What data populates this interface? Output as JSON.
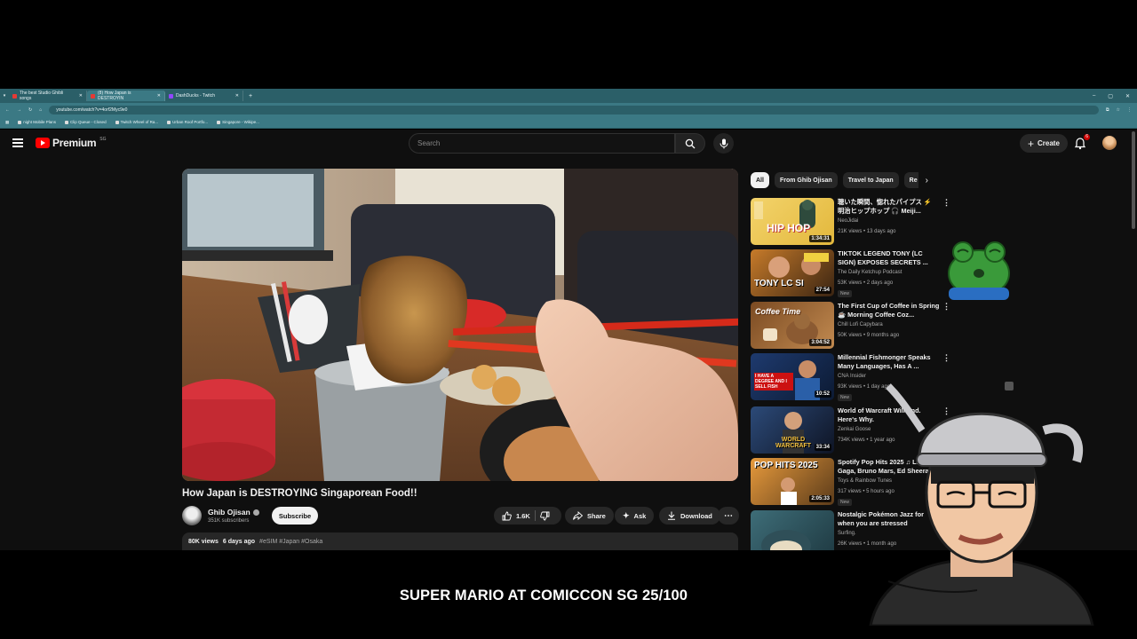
{
  "browser": {
    "tabs": [
      {
        "label": "The best Studio Ghibli songs"
      },
      {
        "label": "(8) How Japan is DESTROYIN"
      },
      {
        "label": "DashDucks - Twitch"
      }
    ],
    "new_tab": "+",
    "window_controls": [
      "–",
      "▢",
      "✕"
    ],
    "url": "youtube.com/watch?v=4orf2Myc9e0",
    "bookmarks": [
      "night Mobile Plans",
      "Clip Queue - Closed",
      "Twitch Wheel of Ra...",
      "Urban Roof Portfo...",
      "Singapore - Wikipe..."
    ]
  },
  "youtube": {
    "logo_text": "Premium",
    "logo_region": "SG",
    "search_placeholder": "Search",
    "create_label": "Create",
    "notification_count": "6"
  },
  "video": {
    "title": "How Japan is DESTROYING Singaporean Food!!",
    "channel": "Ghib Ojisan",
    "subscribers": "351K subscribers",
    "subscribe_label": "Subscribe",
    "likes": "1.6K",
    "share_label": "Share",
    "ask_label": "Ask",
    "download_label": "Download",
    "views": "80K views",
    "age": "6 days ago",
    "tags": "#eSIM #Japan #Osaka"
  },
  "chips": [
    "All",
    "From Ghib Ojisan",
    "Travel to Japan",
    "Re"
  ],
  "recommendations": [
    {
      "title": "聴いた瞬間、惚れたパイプス ⚡ 明治ヒップホップ 🎧 Meiji...",
      "channel": "NeoJidai",
      "views": "21K views",
      "age": "13 days ago",
      "duration": "1:34:31",
      "thumb_text": "HIP HOP",
      "new": false
    },
    {
      "title": "TIKTOK LEGEND TONY (LC SIGN) EXPOSES SECRETS ...",
      "channel": "The Daily Ketchup Podcast",
      "views": "53K views",
      "age": "2 days ago",
      "duration": "27:54",
      "thumb_text": "TONY LC SI",
      "new": true
    },
    {
      "title": "The First Cup of Coffee in Spring ☕ Morning Coffee Coz...",
      "channel": "Chill Lofi Capybara",
      "views": "50K views",
      "age": "9 months ago",
      "duration": "3:04:52",
      "thumb_text": "Coffee Time",
      "new": false
    },
    {
      "title": "Millennial Fishmonger Speaks Many Languages, Has A ...",
      "channel": "CNA Insider",
      "views": "93K views",
      "age": "1 day ago",
      "duration": "10:52",
      "thumb_text": "I HAVE A DEGREE AND I SELL FISH",
      "new": true
    },
    {
      "title": "World of Warcraft Will End. Here's Why.",
      "channel": "Zenkai Goose",
      "views": "734K views",
      "age": "1 year ago",
      "duration": "33:34",
      "thumb_text": "WORLD WARCRAFT",
      "new": false
    },
    {
      "title": "Spotify Pop Hits 2025 ♫ Lady Gaga, Bruno Mars, Ed Sheeran...",
      "channel": "Toys & Rainbow Tunes",
      "views": "317 views",
      "age": "5 hours ago",
      "duration": "2:05:33",
      "thumb_text": "POP HITS 2025",
      "new": true
    },
    {
      "title": "Nostalgic Pokémon Jazz for when you are stressed",
      "channel": "Surfing.",
      "views": "26K views",
      "age": "1 month ago",
      "duration": "",
      "thumb_text": "",
      "new": false
    }
  ],
  "new_badge": "New",
  "overlay": {
    "caption": "SUPER MARIO AT COMICCON SG 25/100"
  }
}
